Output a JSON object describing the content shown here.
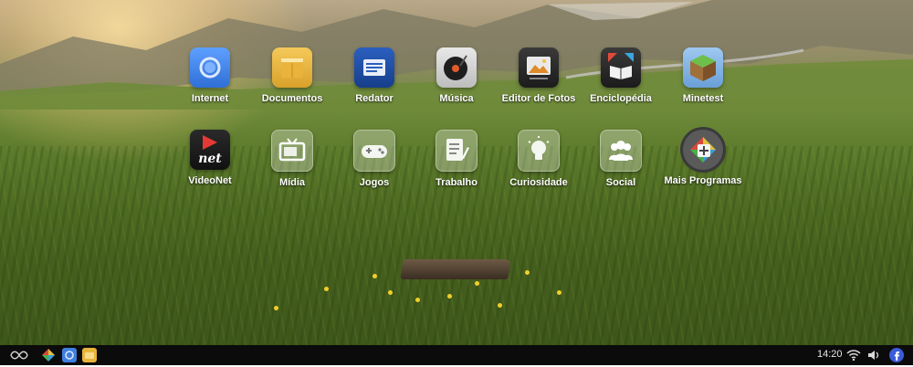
{
  "desktop": {
    "row1": [
      {
        "label": "Internet",
        "icon": "browser-globe-icon"
      },
      {
        "label": "Documentos",
        "icon": "folder-icon"
      },
      {
        "label": "Redator",
        "icon": "text-editor-icon"
      },
      {
        "label": "Música",
        "icon": "music-record-icon"
      },
      {
        "label": "Editor de Fotos",
        "icon": "photo-editor-icon"
      },
      {
        "label": "Enciclopédia",
        "icon": "encyclopedia-book-icon"
      },
      {
        "label": "Minetest",
        "icon": "minetest-cube-icon"
      }
    ],
    "row2": [
      {
        "label": "VideoNet",
        "icon": "videonet-play-icon"
      },
      {
        "label": "Mídia",
        "icon": "tv-icon"
      },
      {
        "label": "Jogos",
        "icon": "gamepad-icon"
      },
      {
        "label": "Trabalho",
        "icon": "document-pen-icon"
      },
      {
        "label": "Curiosidade",
        "icon": "lightbulb-icon"
      },
      {
        "label": "Social",
        "icon": "people-icon"
      },
      {
        "label": "Mais Programas",
        "icon": "add-programs-icon"
      }
    ]
  },
  "taskbar": {
    "time": "14:20",
    "left_icons": [
      "menu-logo-icon",
      "app-store-icon",
      "browser-icon",
      "files-icon"
    ],
    "right_icons": [
      "wifi-icon",
      "volume-icon",
      "facebook-icon"
    ]
  },
  "colors": {
    "taskbar_bg": "#0b0b0b",
    "label_text": "#ffffff",
    "internet_blue": "#3f7fe0",
    "folder_yellow": "#e9b43a",
    "redator_blue": "#1f4fa8",
    "facebook_blue": "#3b5bdb"
  }
}
